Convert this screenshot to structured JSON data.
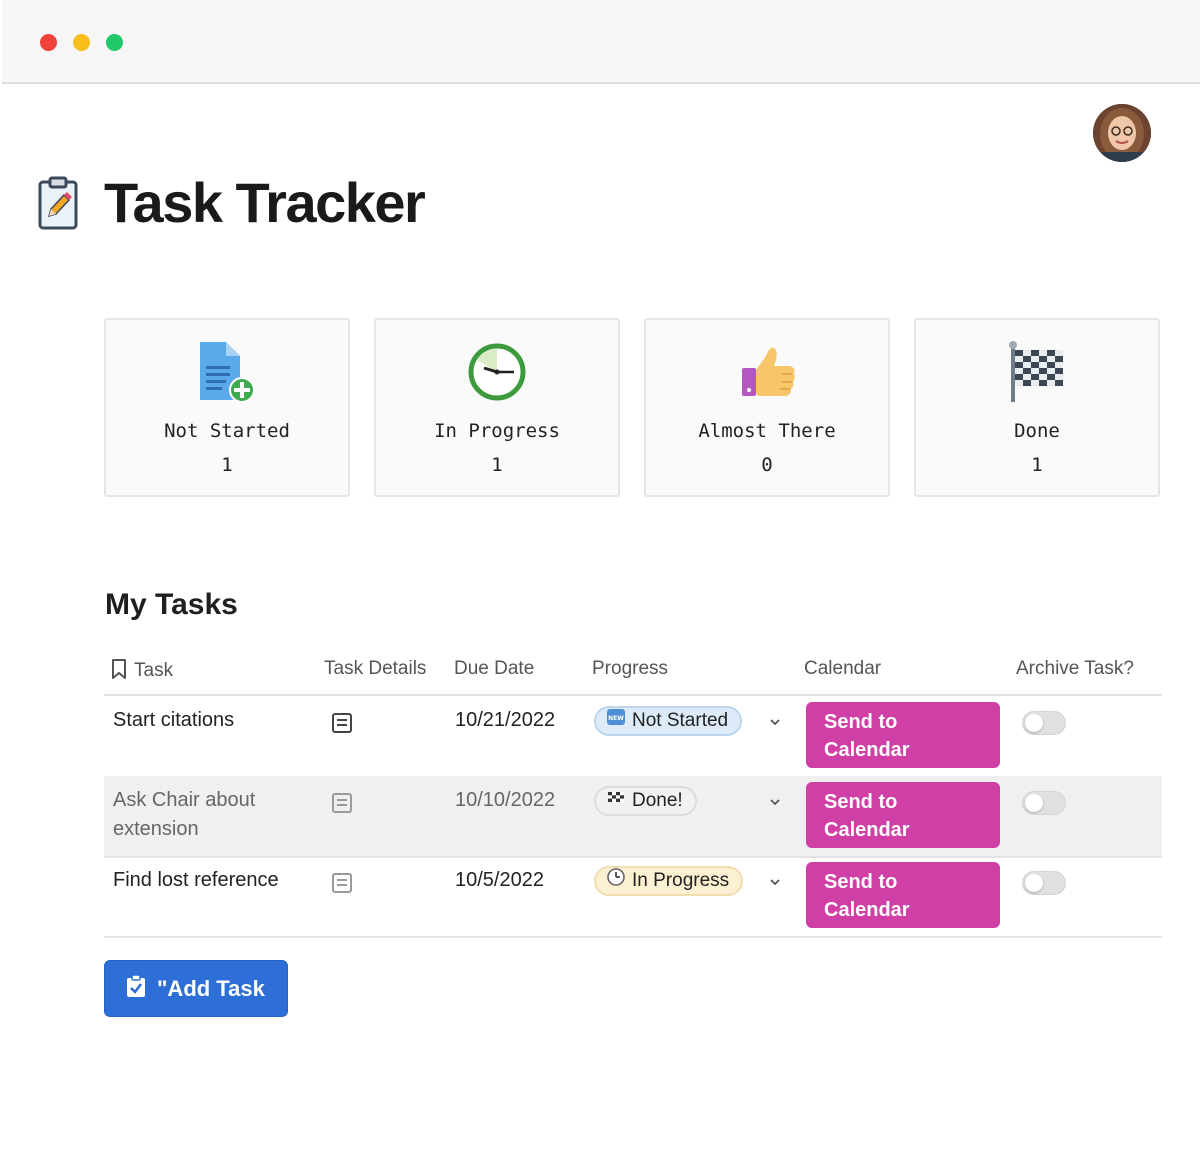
{
  "window": {
    "controls": [
      "close",
      "minimize",
      "maximize"
    ]
  },
  "header": {
    "title": "Task Tracker",
    "icon": "clipboard-pencil-icon",
    "avatar": "user-avatar"
  },
  "status_cards": [
    {
      "label": "Not Started",
      "count": "1",
      "icon": "new-document-icon"
    },
    {
      "label": "In Progress",
      "count": "1",
      "icon": "clock-icon"
    },
    {
      "label": "Almost There",
      "count": "0",
      "icon": "thumbs-up-icon"
    },
    {
      "label": "Done",
      "count": "1",
      "icon": "checkered-flag-icon"
    }
  ],
  "tasks_section": {
    "title": "My Tasks",
    "columns": [
      "Task",
      "Task Details",
      "Due Date",
      "Progress",
      "Calendar",
      "Archive Task?"
    ],
    "rows": [
      {
        "task": "Start citations",
        "due": "10/21/2022",
        "progress": "Not Started",
        "progress_icon": "new-badge-icon",
        "progress_color": "#dcebf7",
        "calendar": "Send to Calendar",
        "archived": false
      },
      {
        "task": "Ask Chair about extension",
        "due": "10/10/2022",
        "progress": "Done!",
        "progress_icon": "checkered-flag-icon",
        "progress_color": "#f1f1f1",
        "calendar": "Send to Calendar",
        "archived": false
      },
      {
        "task": "Find lost reference",
        "due": "10/5/2022",
        "progress": "In Progress",
        "progress_icon": "clock-icon",
        "progress_color": "#fbf0d2",
        "calendar": "Send to Calendar",
        "archived": false
      }
    ]
  },
  "add_task": {
    "label": "\"Add Task",
    "icon": "clipboard-check-icon"
  },
  "colors": {
    "calendar_button": "#cf3fa6",
    "add_button": "#2d6fd6"
  }
}
